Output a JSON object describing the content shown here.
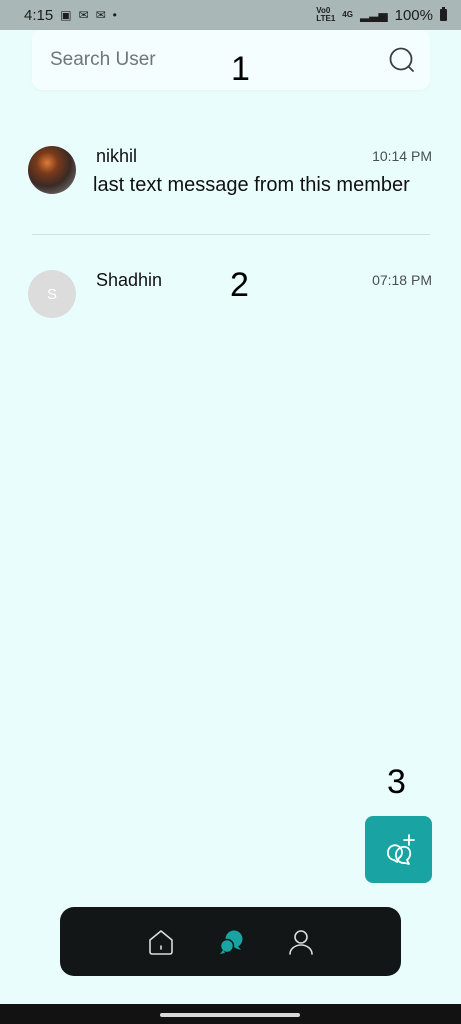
{
  "status_bar": {
    "time": "4:15",
    "network_label_top": "Vo0",
    "network_label_bottom": "LTE1",
    "network_type": "4G",
    "battery": "100%"
  },
  "search": {
    "placeholder": "Search User"
  },
  "annotations": {
    "label_1": "1",
    "label_2": "2",
    "label_3": "3"
  },
  "chats": [
    {
      "name": "nikhil",
      "time": "10:14 PM",
      "message": "last text message from this member"
    },
    {
      "name": "Shadhin",
      "time": "07:18 PM",
      "avatar_letter": "S"
    }
  ],
  "colors": {
    "background": "#e9fdfd",
    "accent": "#1aa3a3",
    "nav_bar": "#121616"
  }
}
